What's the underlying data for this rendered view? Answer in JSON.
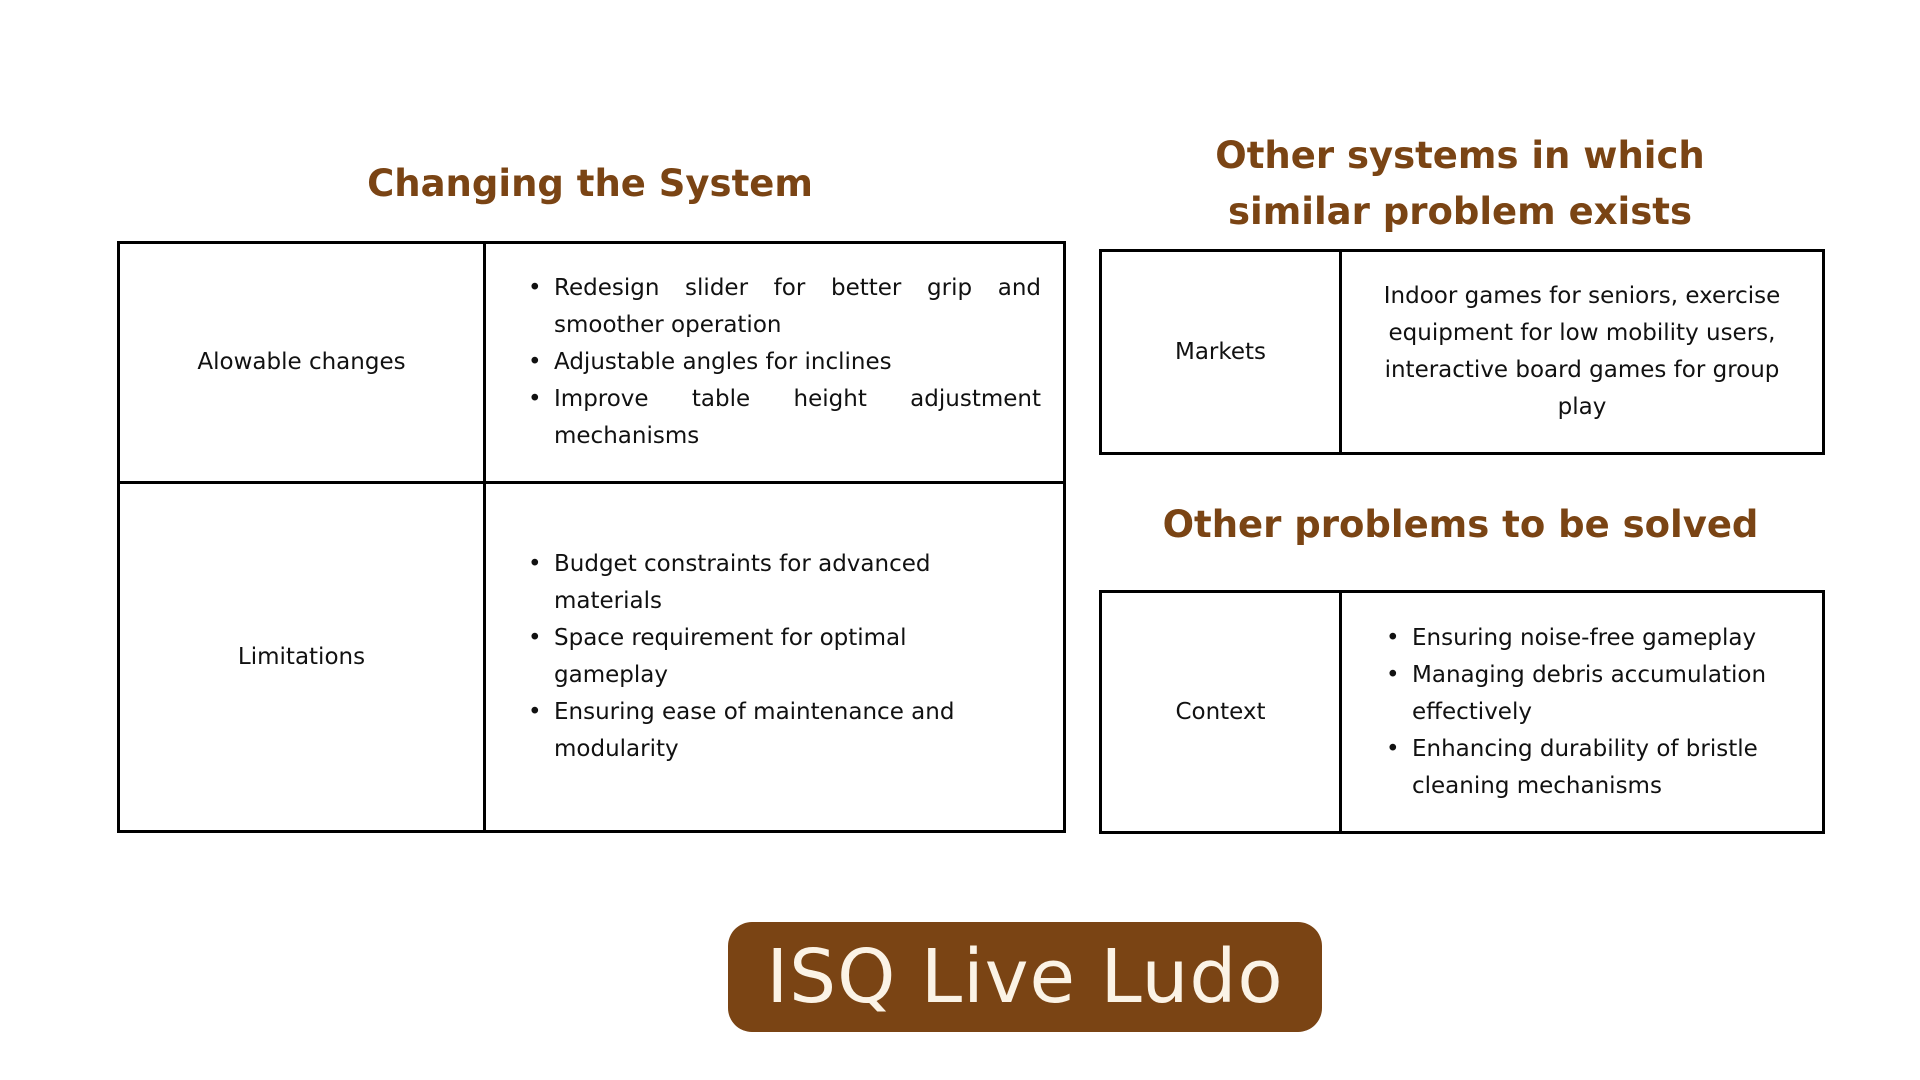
{
  "changing_system": {
    "heading": "Changing the System",
    "rows": [
      {
        "label": "Alowable changes",
        "items": [
          "Redesign slider for better grip and smoother operation",
          "Adjustable angles for inclines",
          "Improve table height adjustment mechanisms"
        ]
      },
      {
        "label": "Limitations",
        "items": [
          "Budget constraints for advanced materials",
          "Space requirement for optimal gameplay",
          "Ensuring ease of maintenance and modularity"
        ]
      }
    ]
  },
  "other_systems": {
    "heading": "Other systems in which similar problem exists",
    "label": "Markets",
    "text": "Indoor games for seniors, exercise equipment for low mobility users, interactive board games for group play"
  },
  "other_problems": {
    "heading": "Other problems to be solved",
    "label": "Context",
    "items": [
      "Ensuring noise-free gameplay",
      "Managing debris accumulation effectively",
      "Enhancing durability of bristle cleaning mechanisms"
    ]
  },
  "brand": {
    "name": "ISQ Live Ludo"
  },
  "colors": {
    "accent": "#7a4414",
    "brand_text": "#fbf3e6",
    "border": "#000000",
    "background": "#ffffff"
  }
}
